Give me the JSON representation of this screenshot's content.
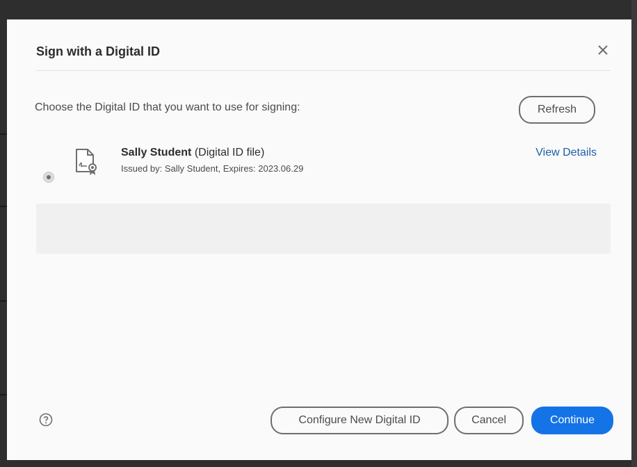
{
  "dialog": {
    "title": "Sign with a Digital ID",
    "prompt": "Choose the Digital ID that you want to use for signing:",
    "refresh_label": "Refresh",
    "digital_ids": [
      {
        "name": "Sally Student",
        "type": "(Digital ID file)",
        "details": "Issued by: Sally Student, Expires: 2023.06.29",
        "selected": true,
        "view_details_label": "View Details"
      }
    ],
    "footer": {
      "configure_label": "Configure New Digital ID",
      "cancel_label": "Cancel",
      "continue_label": "Continue"
    }
  },
  "icons": {
    "close": "close-icon",
    "help": "help-icon",
    "certificate": "certificate-file-icon"
  },
  "colors": {
    "accent": "#1473e6",
    "link": "#1c5fa8",
    "backdrop": "#2e2e2e",
    "dialog_bg": "#fafafa"
  }
}
